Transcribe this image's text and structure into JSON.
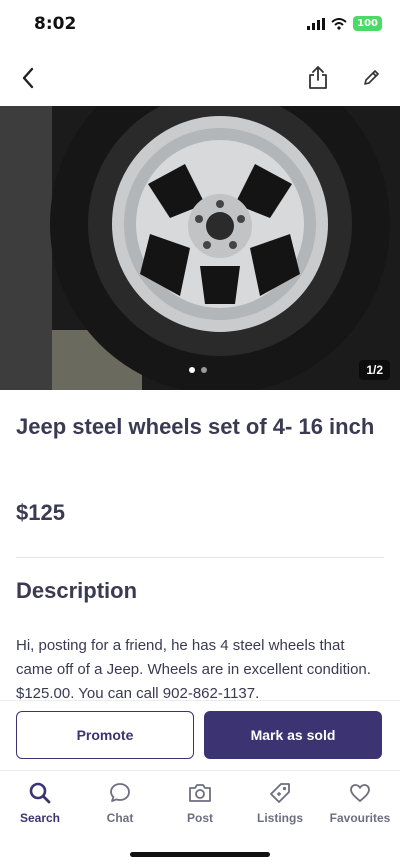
{
  "status": {
    "time": "8:02",
    "battery": "100"
  },
  "listing": {
    "image_counter": "1/2",
    "title": "Jeep steel wheels set of 4- 16 inch",
    "price": "$125",
    "description_heading": "Description",
    "description": "Hi, posting for a friend, he has 4 steel wheels that came off of a Jeep. Wheels are in excellent condition. $125.00. You can call 902-862-1137."
  },
  "actions": {
    "promote_label": "Promote",
    "mark_sold_label": "Mark as sold"
  },
  "tabs": [
    {
      "label": "Search",
      "icon": "search-icon"
    },
    {
      "label": "Chat",
      "icon": "chat-icon"
    },
    {
      "label": "Post",
      "icon": "camera-icon"
    },
    {
      "label": "Listings",
      "icon": "tag-icon"
    },
    {
      "label": "Favourites",
      "icon": "heart-icon"
    }
  ],
  "colors": {
    "accent": "#3c3472",
    "text": "#3a3a52"
  }
}
